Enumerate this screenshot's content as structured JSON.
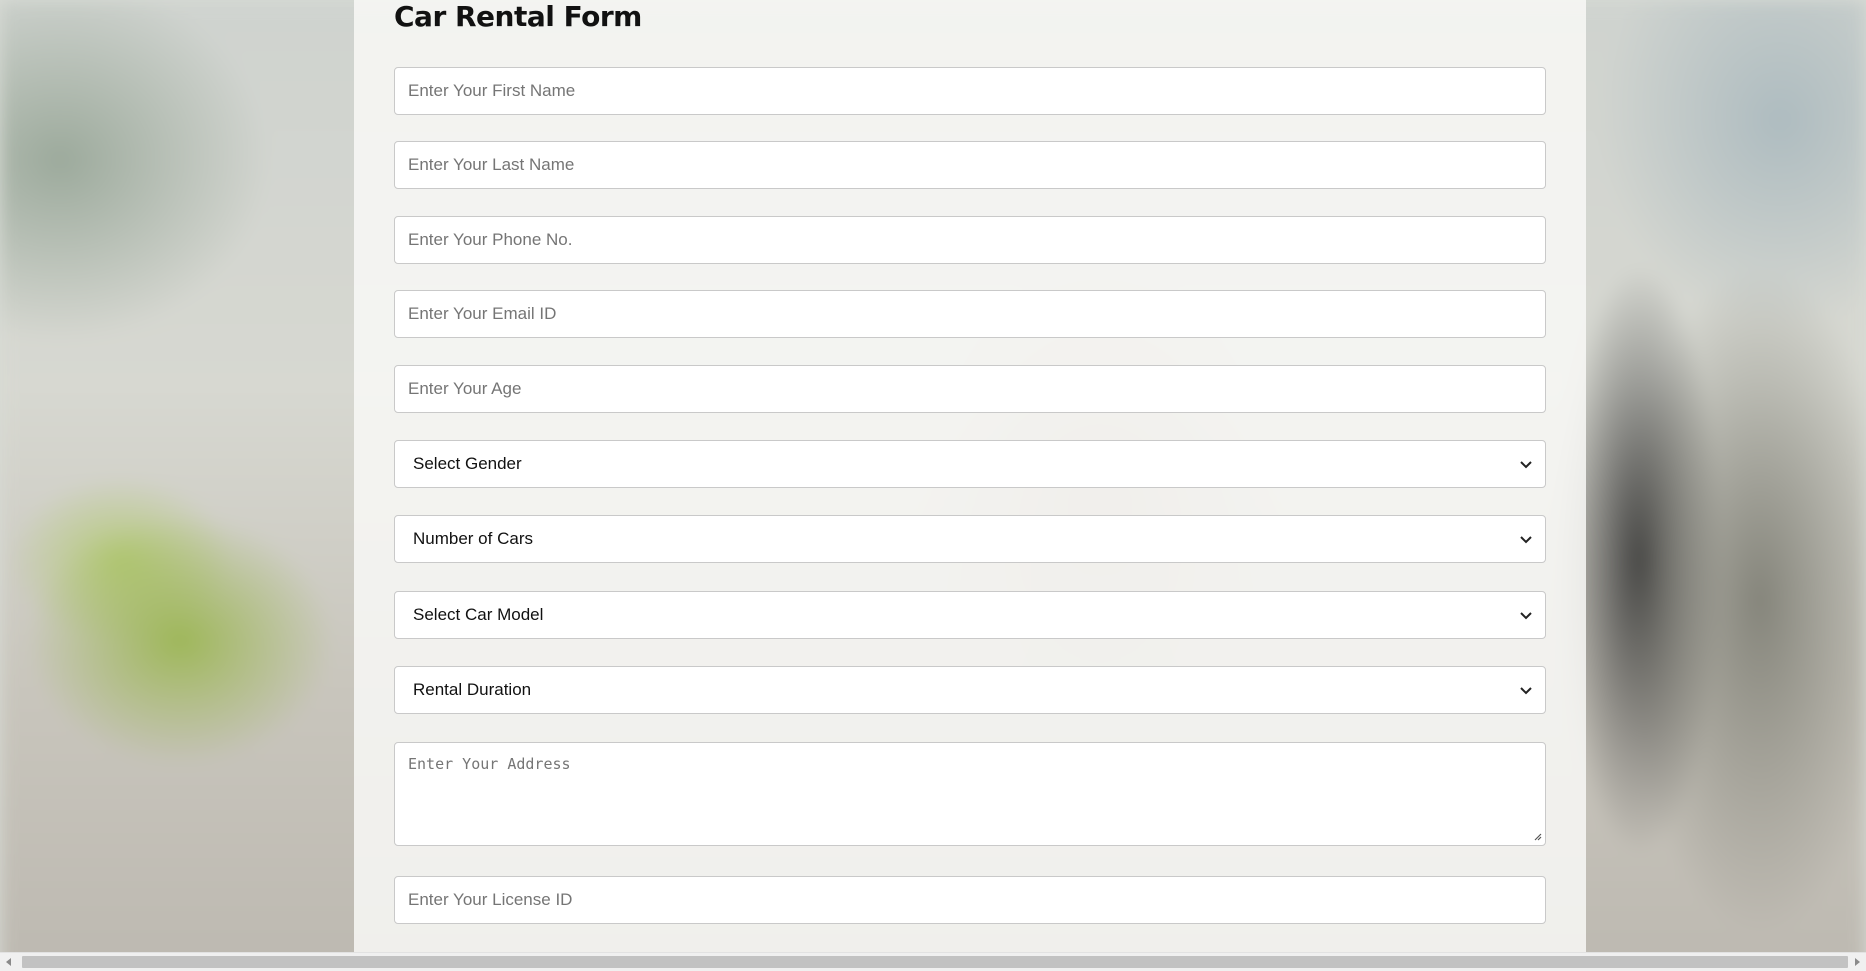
{
  "form": {
    "title": "Car Rental Form",
    "first_name_placeholder": "Enter Your First Name",
    "last_name_placeholder": "Enter Your Last Name",
    "phone_placeholder": "Enter Your Phone No.",
    "email_placeholder": "Enter Your Email ID",
    "age_placeholder": "Enter Your Age",
    "gender_select": "Select Gender",
    "cars_select": "Number of Cars",
    "model_select": "Select Car Model",
    "duration_select": "Rental Duration",
    "address_placeholder": "Enter Your Address",
    "license_placeholder": "Enter Your License ID"
  },
  "icons": {
    "select_arrow": "chevron-down-icon",
    "scroll_left": "triangle-left-icon",
    "scroll_right": "triangle-right-icon"
  }
}
